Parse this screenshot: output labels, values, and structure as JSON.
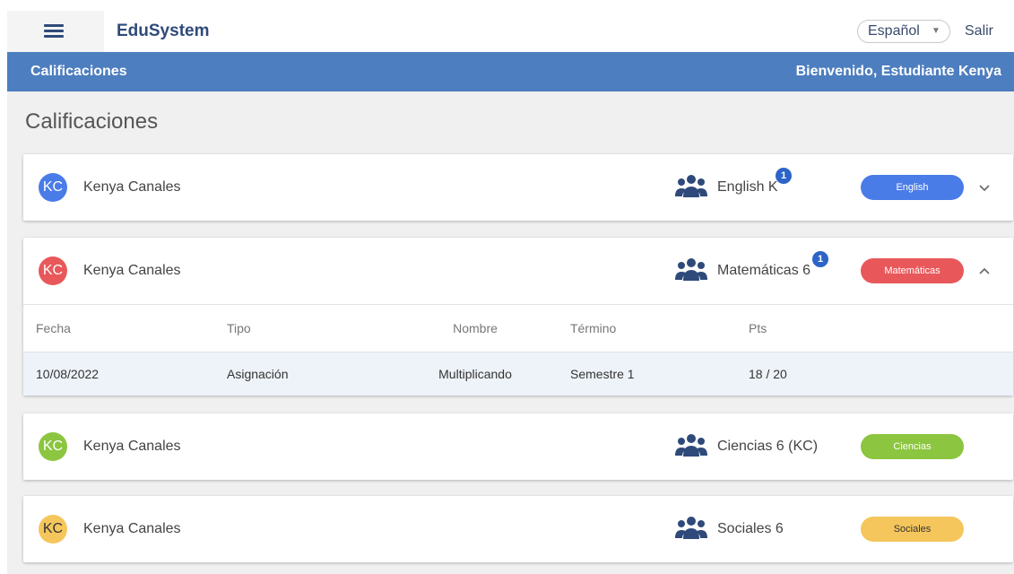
{
  "app": {
    "brand": "EduSystem",
    "language": "Español",
    "logout": "Salir"
  },
  "header": {
    "section": "Calificaciones",
    "welcome": "Bienvenido, Estudiante Kenya"
  },
  "page": {
    "title": "Calificaciones"
  },
  "grade_cards": [
    {
      "initials": "KC",
      "student": "Kenya Canales",
      "course": "English K",
      "badge": "1",
      "tag": "English",
      "color": "#4a7ce8",
      "expanded": false
    },
    {
      "initials": "KC",
      "student": "Kenya Canales",
      "course": "Matemáticas 6",
      "badge": "1",
      "tag": "Matemáticas",
      "color": "#e8585a",
      "expanded": true
    },
    {
      "initials": "KC",
      "student": "Kenya Canales",
      "course": "Ciencias 6 (KC)",
      "tag": "Ciencias",
      "color": "#8cc540"
    },
    {
      "initials": "KC",
      "student": "Kenya Canales",
      "course": "Sociales 6",
      "tag": "Sociales",
      "color": "#f5c65c"
    }
  ],
  "grades_table": {
    "columns": [
      "Fecha",
      "Tipo",
      "Nombre",
      "Término",
      "Pts"
    ],
    "rows": [
      [
        "10/08/2022",
        "Asignación",
        "Multiplicando",
        "Semestre 1",
        "18 / 20"
      ]
    ]
  },
  "icons": {
    "menu": "hamburger-menu-icon",
    "group": "users-group-icon",
    "expand": "chevron-down-icon",
    "collapse": "chevron-up-icon",
    "dropdown": "caret-down-icon"
  }
}
